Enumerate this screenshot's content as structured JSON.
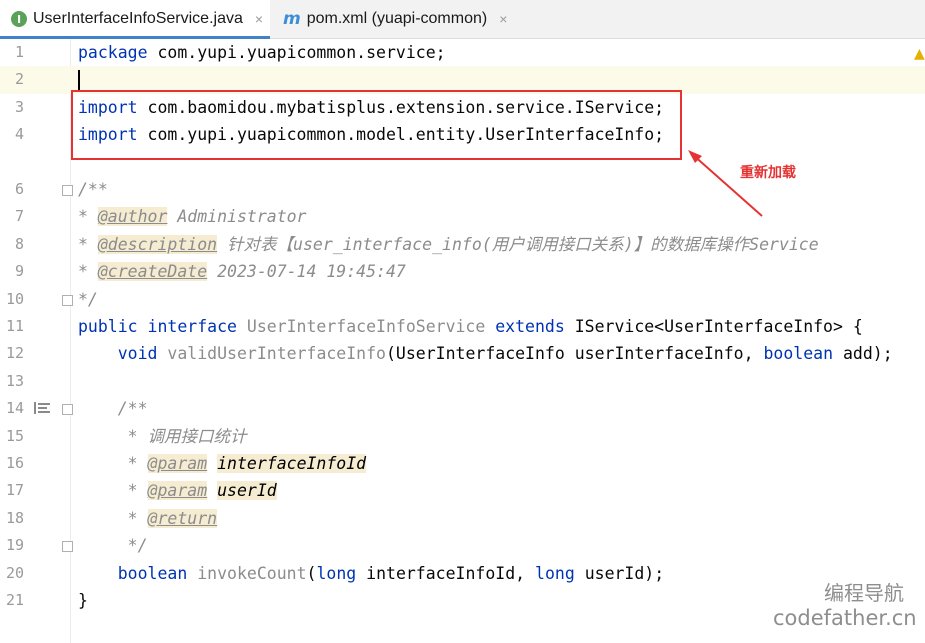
{
  "tabs": [
    {
      "icon": "I",
      "label": "UserInterfaceInfoService.java",
      "close": "×",
      "active": true
    },
    {
      "icon": "m",
      "label": "pom.xml (yuapi-common)",
      "close": "×",
      "active": false
    }
  ],
  "gutter": {
    "line_numbers": [
      "1",
      "2",
      "3",
      "4",
      "6",
      "7",
      "8",
      "9",
      "10",
      "11",
      "12",
      "13",
      "14",
      "15",
      "16",
      "17",
      "18",
      "19",
      "20",
      "21"
    ]
  },
  "code": {
    "l1": {
      "kw": "package",
      "rest": " com.yupi.yuapicommon.service;"
    },
    "l3": {
      "kw": "import",
      "rest": " com.baomidou.mybatisplus.extension.service.IService;"
    },
    "l4": {
      "kw": "import",
      "rest": " com.yupi.yuapicommon.model.entity.UserInterfaceInfo;"
    },
    "l6": {
      "text": "/**"
    },
    "l7": {
      "star": "* ",
      "tag": "@author",
      "rest": " Administrator"
    },
    "l8": {
      "star": "* ",
      "tag": "@description",
      "rest": " 针对表【user_interface_info(用户调用接口关系)】的数据库操作Service"
    },
    "l9": {
      "star": "* ",
      "tag": "@createDate",
      "rest": " 2023-07-14 19:45:47"
    },
    "l10": {
      "text": "*/"
    },
    "l11": {
      "kw1": "public interface",
      "name": " UserInterfaceInfoService ",
      "kw2": "extends",
      "rest": " IService<UserInterfaceInfo> {"
    },
    "l12": {
      "indent": "    ",
      "kw1": "void",
      "name": " validUserInterfaceInfo",
      "p1": "(UserInterfaceInfo userInterfaceInfo, ",
      "kw2": "boolean",
      "p2": " add);"
    },
    "l14": {
      "indent": "    ",
      "text": "/**"
    },
    "l15": {
      "indent": "     ",
      "text": "* 调用接口统计"
    },
    "l16": {
      "indent": "     ",
      "star": "* ",
      "tag": "@param",
      "sp": " ",
      "pv": "interfaceInfoId"
    },
    "l17": {
      "indent": "     ",
      "star": "* ",
      "tag": "@param",
      "sp": " ",
      "pv": "userId"
    },
    "l18": {
      "indent": "     ",
      "star": "* ",
      "tag": "@return"
    },
    "l19": {
      "indent": "     ",
      "text": "*/"
    },
    "l20": {
      "indent": "    ",
      "kw1": "boolean",
      "name": " invokeCount",
      "p1": "(",
      "kw2": "long",
      "p2": " interfaceInfoId, ",
      "kw3": "long",
      "p3": " userId);"
    },
    "l21": {
      "text": "}"
    }
  },
  "annotation": {
    "text": "重新加载",
    "color": "#e53333"
  },
  "watermark": {
    "line1": "编程导航",
    "line2": "codefather.cn"
  },
  "colors": {
    "keyword": "#0033b3",
    "comment": "#8c8c8c",
    "accent": "#4083c9"
  }
}
